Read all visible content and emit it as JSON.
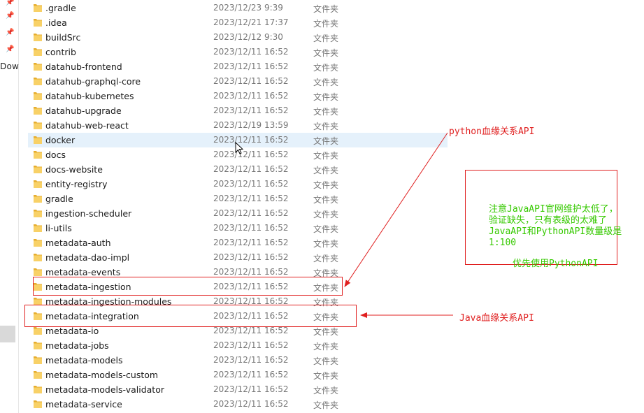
{
  "left_pane": {
    "label": "Dow"
  },
  "type_label": "文件夹",
  "folders": [
    {
      "name": ".gradle",
      "date": "2023/12/23 9:39"
    },
    {
      "name": ".idea",
      "date": "2023/12/21 17:37"
    },
    {
      "name": "buildSrc",
      "date": "2023/12/12 9:30"
    },
    {
      "name": "contrib",
      "date": "2023/12/11 16:52"
    },
    {
      "name": "datahub-frontend",
      "date": "2023/12/11 16:52"
    },
    {
      "name": "datahub-graphql-core",
      "date": "2023/12/11 16:52"
    },
    {
      "name": "datahub-kubernetes",
      "date": "2023/12/11 16:52"
    },
    {
      "name": "datahub-upgrade",
      "date": "2023/12/11 16:52"
    },
    {
      "name": "datahub-web-react",
      "date": "2023/12/19 13:59"
    },
    {
      "name": "docker",
      "date": "2023/12/11 16:52",
      "selected": true
    },
    {
      "name": "docs",
      "date": "2023/12/11 16:52"
    },
    {
      "name": "docs-website",
      "date": "2023/12/11 16:52"
    },
    {
      "name": "entity-registry",
      "date": "2023/12/11 16:52"
    },
    {
      "name": "gradle",
      "date": "2023/12/11 16:52"
    },
    {
      "name": "ingestion-scheduler",
      "date": "2023/12/11 16:52"
    },
    {
      "name": "li-utils",
      "date": "2023/12/11 16:52"
    },
    {
      "name": "metadata-auth",
      "date": "2023/12/11 16:52"
    },
    {
      "name": "metadata-dao-impl",
      "date": "2023/12/11 16:52"
    },
    {
      "name": "metadata-events",
      "date": "2023/12/11 16:52"
    },
    {
      "name": "metadata-ingestion",
      "date": "2023/12/11 16:52"
    },
    {
      "name": "metadata-ingestion-modules",
      "date": "2023/12/11 16:52"
    },
    {
      "name": "metadata-integration",
      "date": "2023/12/11 16:52"
    },
    {
      "name": "metadata-io",
      "date": "2023/12/11 16:52"
    },
    {
      "name": "metadata-jobs",
      "date": "2023/12/11 16:52"
    },
    {
      "name": "metadata-models",
      "date": "2023/12/11 16:52"
    },
    {
      "name": "metadata-models-custom",
      "date": "2023/12/11 16:52"
    },
    {
      "name": "metadata-models-validator",
      "date": "2023/12/11 16:52"
    },
    {
      "name": "metadata-service",
      "date": "2023/12/11 16:52"
    }
  ],
  "annotations": {
    "python_label": "python血缘关系API",
    "java_label": "Java血缘关系API",
    "note_lines": [
      "注意JavaAPI官网维护太低了，",
      "验证缺失，只有表级的太难了",
      "JavaAPI和PythonAPI数量级是",
      "1:100"
    ],
    "note_footer": "优先使用PythonAPI",
    "colors": {
      "annotation_red": "#e02020",
      "note_green": "#36c900",
      "folder_yellow": "#f4c542",
      "selection_blue": "#e5f1fb"
    }
  }
}
